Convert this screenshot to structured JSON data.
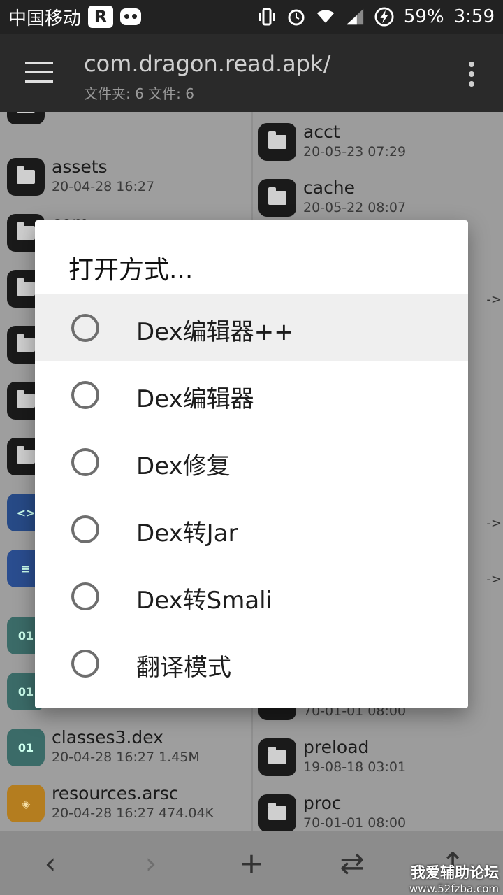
{
  "status_bar": {
    "carrier": "中国移动",
    "battery": "59%",
    "time": "3:59",
    "badge_letter": "R"
  },
  "app_bar": {
    "title": "com.dragon.read.apk/",
    "subtitle": "文件夹: 6  文件: 6"
  },
  "left_panel": {
    "items": [
      {
        "name": "",
        "meta": ""
      },
      {
        "name": "assets",
        "meta": "20-04-28 16:27"
      },
      {
        "name": "com",
        "meta": ""
      },
      {
        "name": "",
        "meta": ""
      },
      {
        "name": "",
        "meta": ""
      },
      {
        "name": "",
        "meta": ""
      },
      {
        "name": "",
        "meta": ""
      },
      {
        "name": "",
        "meta": ""
      },
      {
        "name": "",
        "meta": ""
      },
      {
        "name": "",
        "meta": ""
      },
      {
        "name": "",
        "meta": ""
      },
      {
        "name": "classes3.dex",
        "meta": "20-04-28 16:27  1.45M"
      },
      {
        "name": "resources.arsc",
        "meta": "20-04-28 16:27  474.04K"
      }
    ]
  },
  "right_panel": {
    "items": [
      {
        "name": "acct",
        "meta": "20-05-23 07:29"
      },
      {
        "name": "cache",
        "meta": "20-05-22 08:07"
      },
      {
        "name": "",
        "meta": "70-01-01 08:00"
      },
      {
        "name": "preload",
        "meta": "19-08-18 03:01"
      },
      {
        "name": "proc",
        "meta": "70-01-01 08:00"
      }
    ],
    "link_arrow": "->"
  },
  "dialog": {
    "title": "打开方式...",
    "options": [
      {
        "label": "Dex编辑器++",
        "highlighted": true
      },
      {
        "label": "Dex编辑器"
      },
      {
        "label": "Dex修复"
      },
      {
        "label": "Dex转Jar"
      },
      {
        "label": "Dex转Smali"
      },
      {
        "label": "翻译模式"
      }
    ]
  },
  "bottom_bar": {
    "back": "‹",
    "forward": "›",
    "add": "+",
    "swap": "⇄",
    "up": "↑"
  },
  "watermark": {
    "line1": "我爱辅助论坛",
    "line2": "www.52fzba.com"
  }
}
